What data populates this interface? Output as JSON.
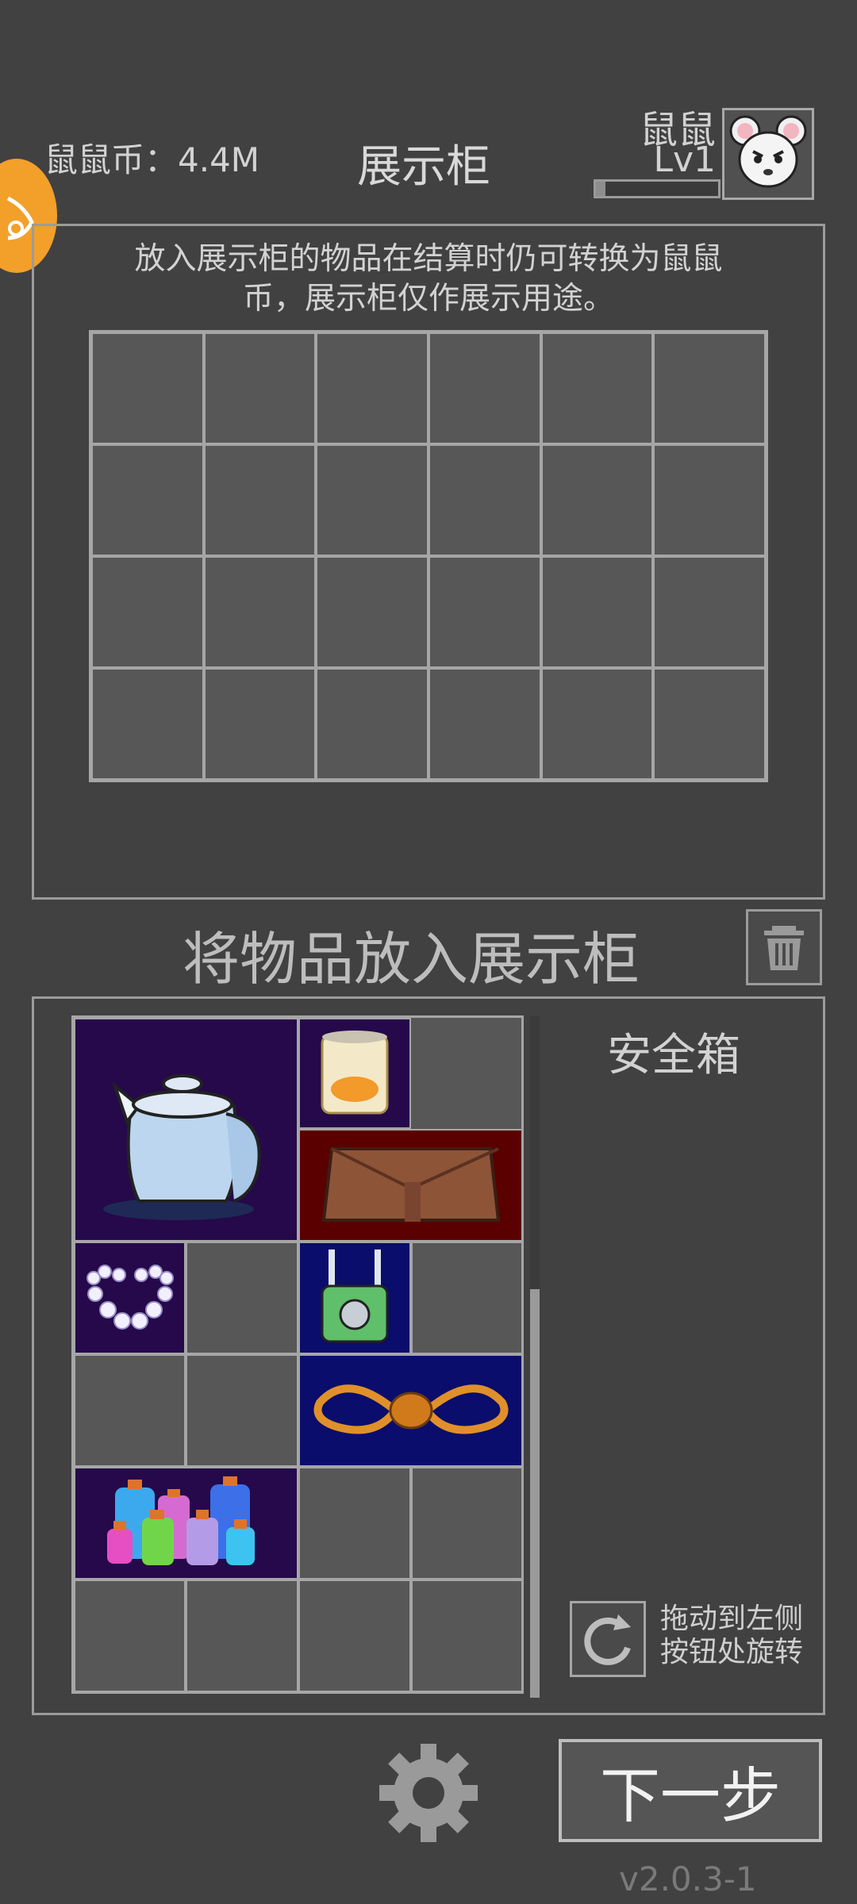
{
  "header": {
    "coins_text": "鼠鼠币：4.4M",
    "title": "展示柜",
    "player_name": "鼠鼠",
    "player_level": "Lv1",
    "xp_fraction": 0.08
  },
  "display_cabinet": {
    "notice_line1": "放入展示柜的物品在结算时仍可转换为鼠鼠",
    "notice_line2": "币，展示柜仅作展示用途。",
    "rows": 4,
    "cols": 6
  },
  "prompt": "将物品放入展示柜",
  "safebox_label": "安全箱",
  "rotate_hint_line1": "拖动到左侧",
  "rotate_hint_line2": "按钮处旋转",
  "next_button": "下一步",
  "version": "v2.0.3-1",
  "colors": {
    "background": "#414141",
    "rarity_purple": "#26094a",
    "rarity_blue": "#0a0d6b",
    "rarity_red": "#5a0000",
    "badge_orange": "#f2a02a"
  },
  "inventory_items": [
    {
      "icon": "kettle-icon",
      "rarity": "purple"
    },
    {
      "icon": "canned-food-icon",
      "rarity": "purple"
    },
    {
      "icon": "leather-wallet-icon",
      "rarity": "red"
    },
    {
      "icon": "pearl-necklace-icon",
      "rarity": "purple"
    },
    {
      "icon": "wifi-router-icon",
      "rarity": "blue"
    },
    {
      "icon": "rope-icon",
      "rarity": "blue"
    },
    {
      "icon": "potion-bottles-icon",
      "rarity": "purple"
    }
  ]
}
